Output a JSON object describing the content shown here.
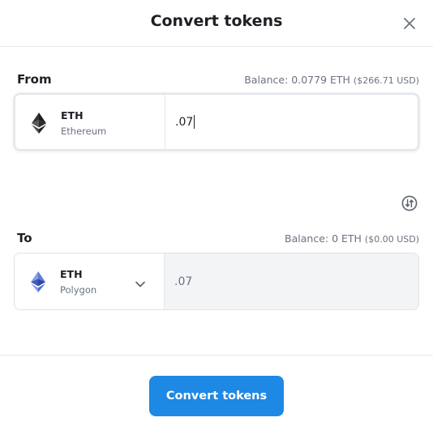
{
  "header": {
    "title": "Convert tokens",
    "close_icon": "close-icon"
  },
  "from": {
    "label": "From",
    "balance": "Balance: 0.0779 ETH",
    "balance_usd": "($266.71 USD)",
    "token_symbol": "ETH",
    "token_network": "Ethereum",
    "token_icon": "ethereum-icon",
    "amount": ".07"
  },
  "to": {
    "label": "To",
    "balance": "Balance: 0 ETH",
    "balance_usd": "($0.00 USD)",
    "token_symbol": "ETH",
    "token_network": "Polygon",
    "token_icon": "ethereum-polygon-icon",
    "amount": ".07"
  },
  "swap_icon": "swap-direction-icon",
  "convert_button": "Convert tokens",
  "colors": {
    "accent": "#1e88e5",
    "text": "#1d1f24",
    "muted": "#6b7280"
  }
}
